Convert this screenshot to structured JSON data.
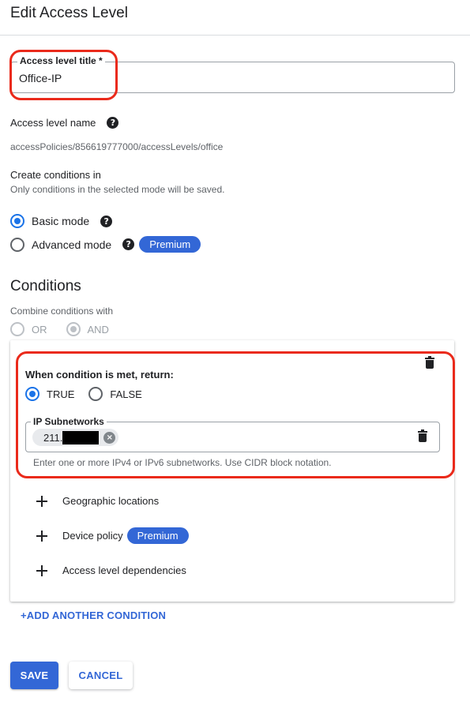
{
  "header": {
    "title": "Edit Access Level"
  },
  "title_field": {
    "label": "Access level title *",
    "value": "Office-IP"
  },
  "access_level_name": {
    "label": "Access level name",
    "help_icon": "help-circle-icon",
    "value": "accessPolicies/856619777000/accessLevels/office"
  },
  "create_conditions": {
    "heading": "Create conditions in",
    "subheading": "Only conditions in the selected mode will be saved.",
    "modes": [
      {
        "label": "Basic mode",
        "selected": true
      },
      {
        "label": "Advanced mode",
        "selected": false,
        "badge": "Premium"
      }
    ]
  },
  "conditions": {
    "title": "Conditions",
    "combine_label": "Combine conditions with",
    "combine_options": [
      {
        "label": "OR",
        "selected": false
      },
      {
        "label": "AND",
        "selected": true
      }
    ],
    "card": {
      "when_label": "When condition is met, return:",
      "return_options": [
        {
          "label": "TRUE",
          "selected": true
        },
        {
          "label": "FALSE",
          "selected": false
        }
      ],
      "ip_field": {
        "label": "IP Subnetworks",
        "chip_value": "211.",
        "helper": "Enter one or more IPv4 or IPv6 subnetworks. Use CIDR block notation."
      },
      "add_items": [
        {
          "label": "Geographic locations"
        },
        {
          "label": "Device policy",
          "badge": "Premium"
        },
        {
          "label": "Access level dependencies"
        }
      ]
    },
    "add_condition_label": "+ADD ANOTHER CONDITION"
  },
  "actions": {
    "save_label": "SAVE",
    "cancel_label": "CANCEL"
  },
  "colors": {
    "accent": "#3367d6",
    "radio_selected": "#1a73e8",
    "highlight": "#ea2a1b"
  }
}
